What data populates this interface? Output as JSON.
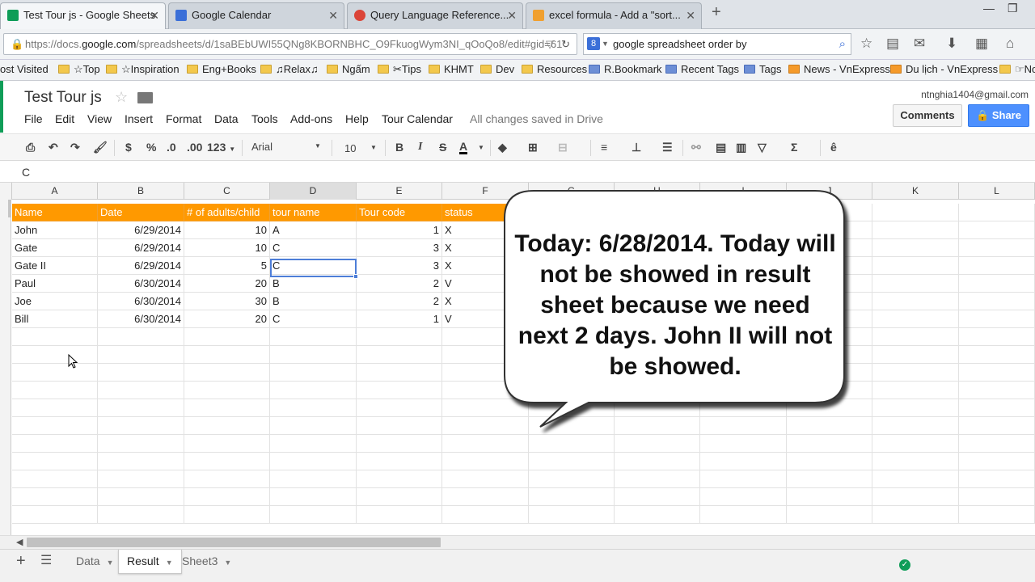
{
  "browser": {
    "tabs": [
      {
        "title": "Test Tour js - Google Sheets",
        "active": true,
        "color": "#0f9d58"
      },
      {
        "title": "Google Calendar",
        "active": false,
        "color": "#3b6fd8"
      },
      {
        "title": "Query Language Reference...",
        "active": false,
        "color": "#db4437"
      },
      {
        "title": "excel formula - Add a \"sort...",
        "active": false,
        "color": "#f0a030"
      }
    ],
    "url_prefix": "https://docs.",
    "url_domain": "google.com",
    "url_rest": "/spreadsheets/d/1saBEbUWI55QNg8KBORNBHC_O9FkuogWym3NI_qOoQo8/edit#gid=61",
    "search_text": "google spreadsheet order by",
    "search_badge": "8",
    "bookmarks": [
      "ost Visited",
      "☆Top",
      "☆Inspiration",
      "Eng+Books",
      "♫Relax♫",
      "Ngấm",
      "✂Tips",
      "KHMT",
      "Dev",
      "Resources",
      "R.Bookmark",
      "Recent Tags",
      "Tags",
      "News - VnExpress",
      "Du lịch - VnExpress",
      "☞No"
    ]
  },
  "sheets": {
    "title": "Test Tour js",
    "menus": [
      "File",
      "Edit",
      "View",
      "Insert",
      "Format",
      "Data",
      "Tools",
      "Add-ons",
      "Help",
      "Tour Calendar"
    ],
    "saved_status": "All changes saved in Drive",
    "user_email": "ntnghia1404@gmail.com",
    "comments_label": "Comments",
    "share_label": "Share",
    "toolbar": {
      "currency": "$",
      "percent": "%",
      "dec_less": ".0",
      "dec_more": ".00",
      "format_more": "123",
      "font": "Arial",
      "font_size": "10",
      "bold": "B",
      "italic": "I",
      "strike": "S",
      "text_color": "A",
      "sum": "Σ"
    },
    "formula_value": "C",
    "columns": [
      "A",
      "B",
      "C",
      "D",
      "E",
      "F",
      "G",
      "H",
      "I",
      "J",
      "K",
      "L"
    ],
    "header": [
      "Name",
      "Date",
      "# of adults/child",
      "tour name",
      "Tour code",
      "status"
    ],
    "rows": [
      [
        "John",
        "6/29/2014",
        "10",
        "A",
        "1",
        "X"
      ],
      [
        "Gate",
        "6/29/2014",
        "10",
        "C",
        "3",
        "X"
      ],
      [
        "Gate II",
        "6/29/2014",
        "5",
        "C",
        "3",
        "X"
      ],
      [
        "Paul",
        "6/30/2014",
        "20",
        "B",
        "2",
        "V"
      ],
      [
        "Joe",
        "6/30/2014",
        "30",
        "B",
        "2",
        "X"
      ],
      [
        "Bill",
        "6/30/2014",
        "20",
        "C",
        "1",
        "V"
      ]
    ],
    "header_color": "#ff9900",
    "sheet_tabs": [
      "Data",
      "Result",
      "Sheet3"
    ],
    "active_sheet": "Result"
  },
  "callout_text": "Today: 6/28/2014. Today will not be showed in result sheet  because we need next 2 days. John II will not be showed."
}
